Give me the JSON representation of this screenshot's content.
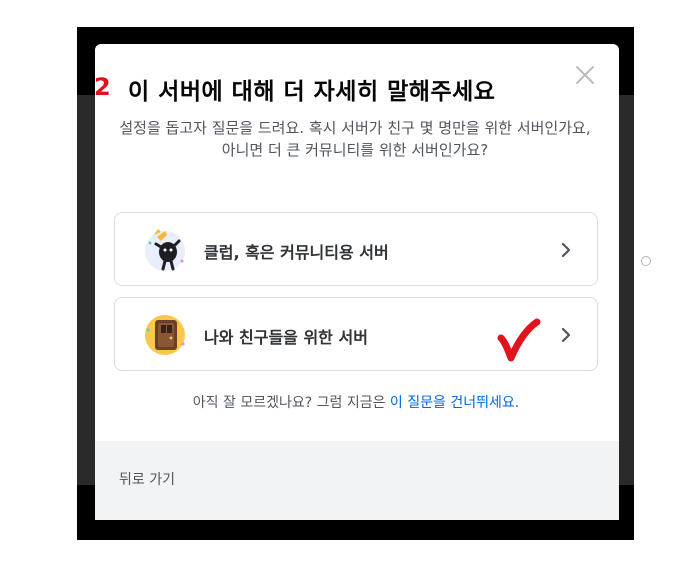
{
  "modal": {
    "step_marker": "2",
    "title": "이 서버에 대해 더 자세히 말해주세요",
    "subtitle": "설정을 돕고자 질문을 드려요. 혹시 서버가 친구 몇 명만을 위한 서버인가요, 아니면 더 큰 커뮤니티를 위한 서버인가요?",
    "close_icon": "close-icon",
    "options": [
      {
        "label": "클럽, 혹은 커뮤니티용 서버",
        "icon": "club-community-icon"
      },
      {
        "label": "나와 친구들을 위한 서버",
        "icon": "friends-door-icon"
      }
    ],
    "skip_prefix": "아직 잘 모르겠나요? 그럼 지금은 ",
    "skip_link": "이 질문을 건너뛰세요",
    "skip_suffix": ".",
    "back_label": "뒤로 가기"
  },
  "colors": {
    "accent_link": "#0068e0",
    "annotation_red": "#e0141e",
    "footer_bg": "#f2f3f5"
  }
}
